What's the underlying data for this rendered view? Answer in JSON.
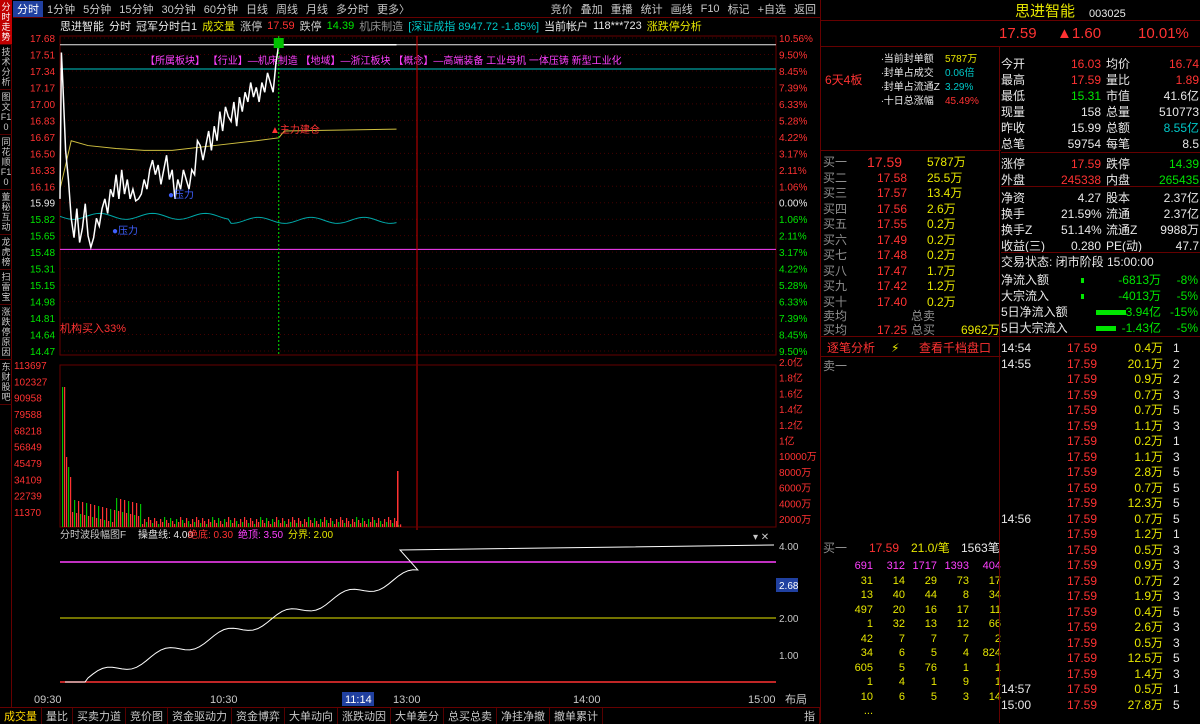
{
  "sidebar": [
    "分时走势",
    "技术分析",
    "图文F10",
    "同花顺F10",
    "董秘互动",
    "龙虎榜",
    "扫雷宝",
    "涨跌停原因",
    "东财股吧"
  ],
  "toolbar": {
    "tabs": [
      "分时",
      "1分钟",
      "5分钟",
      "15分钟",
      "30分钟",
      "60分钟",
      "日线",
      "周线",
      "月线",
      "多分时",
      "更多〉"
    ],
    "right": [
      "竞价",
      "叠加",
      "重播",
      "统计",
      "画线",
      "F10",
      "标记",
      "+自选",
      "返回"
    ]
  },
  "info": {
    "name": "思进智能",
    "label_fenshi": "分时",
    "indicator": "冠军分时白1",
    "vol_label": "成交量",
    "zt_label": "涨停",
    "zt": "17.59",
    "dt_label": "跌停",
    "dt": "14.39",
    "industry": "机床制造",
    "index": "[深证成指 8947.72 -1.85%]",
    "account": "当前帐户",
    "account_val": "118***723",
    "analysis": "涨跌停分析"
  },
  "chart": {
    "price_ticks": [
      "17.68",
      "17.51",
      "17.34",
      "17.17",
      "17.00",
      "16.83",
      "16.67",
      "16.50",
      "16.33",
      "16.16",
      "15.99",
      "15.82",
      "15.65",
      "15.48",
      "15.31",
      "15.15",
      "14.98",
      "14.81",
      "14.64",
      "14.47"
    ],
    "pct_ticks": [
      "10.56%",
      "9.50%",
      "8.45%",
      "7.39%",
      "6.33%",
      "5.28%",
      "4.22%",
      "3.17%",
      "2.11%",
      "1.06%",
      "0.00%",
      "1.06%",
      "2.11%",
      "3.17%",
      "4.22%",
      "5.28%",
      "6.33%",
      "7.39%",
      "8.45%",
      "9.50%"
    ],
    "vol_ticks": [
      "113697",
      "102327",
      "90958",
      "79588",
      "68218",
      "56849",
      "45479",
      "34109",
      "22739",
      "11370"
    ],
    "vol_right": [
      "2.0亿",
      "1.8亿",
      "1.6亿",
      "1.4亿",
      "1.2亿",
      "1亿",
      "10000万",
      "8000万",
      "6000万",
      "4000万",
      "2000万"
    ],
    "sectors": "【所属板块】 【行业】—机床制造 【地域】—浙江板块 【概念】—高端装备 工业母机 一体压铸 新型工业化",
    "inst": "机构买入33%",
    "mark_dt": "主力建仓",
    "mark_bl": "压力",
    "mark_bl2": "压力",
    "price_line": [
      [
        0,
        16.0
      ],
      [
        0.5,
        17.51
      ],
      [
        1,
        17.2
      ],
      [
        2,
        16.5
      ],
      [
        3,
        16.2
      ],
      [
        4,
        15.8
      ],
      [
        5,
        15.6
      ],
      [
        6,
        15.9
      ],
      [
        7,
        15.55
      ],
      [
        8,
        15.7
      ],
      [
        9,
        15.95
      ],
      [
        10,
        15.62
      ],
      [
        11,
        15.5
      ],
      [
        12,
        15.6
      ],
      [
        13,
        15.8
      ],
      [
        14,
        15.72
      ],
      [
        15,
        15.9
      ],
      [
        16,
        16.0
      ],
      [
        17,
        15.85
      ],
      [
        18,
        16.1
      ],
      [
        19,
        16.02
      ],
      [
        20,
        16.25
      ],
      [
        21,
        16.0
      ],
      [
        22,
        16.3
      ],
      [
        23,
        16.05
      ],
      [
        24,
        16.2
      ],
      [
        25,
        16.0
      ],
      [
        26,
        16.1
      ],
      [
        27,
        15.98
      ],
      [
        28,
        16.0
      ],
      [
        29,
        16.05
      ],
      [
        30,
        16.2
      ],
      [
        31,
        16.1
      ],
      [
        32,
        16.3
      ],
      [
        33,
        16.4
      ],
      [
        34,
        16.25
      ],
      [
        35,
        16.35
      ],
      [
        36,
        16.15
      ],
      [
        37,
        16.3
      ],
      [
        38,
        16.45
      ],
      [
        39,
        16.2
      ],
      [
        40,
        16.3
      ],
      [
        41,
        16.0
      ],
      [
        42,
        16.2
      ],
      [
        43,
        16.1
      ],
      [
        44,
        16.3
      ],
      [
        45,
        16.2
      ],
      [
        46,
        16.1
      ],
      [
        47,
        16.3
      ],
      [
        48,
        16.25
      ],
      [
        49,
        16.6
      ],
      [
        50,
        16.55
      ],
      [
        51,
        16.4
      ],
      [
        52,
        16.55
      ],
      [
        53,
        16.7
      ],
      [
        54,
        16.5
      ],
      [
        55,
        16.75
      ],
      [
        56,
        16.6
      ],
      [
        57,
        16.9
      ],
      [
        58,
        16.7
      ],
      [
        59,
        16.95
      ],
      [
        60,
        16.85
      ],
      [
        61,
        16.8
      ],
      [
        62,
        17.0
      ],
      [
        63,
        16.75
      ],
      [
        64,
        17.05
      ],
      [
        65,
        16.9
      ],
      [
        66,
        17.1
      ],
      [
        67,
        17.0
      ],
      [
        68,
        17.2
      ],
      [
        69,
        17.05
      ],
      [
        70,
        17.15
      ],
      [
        71,
        17.0
      ],
      [
        72,
        17.2
      ],
      [
        73,
        17.1
      ],
      [
        74,
        17.3
      ],
      [
        75,
        17.2
      ],
      [
        76,
        17.1
      ],
      [
        77,
        17.4
      ],
      [
        78,
        17.59
      ],
      [
        120,
        17.59
      ]
    ],
    "avg_line": [
      [
        0,
        16.1
      ],
      [
        4,
        16.6
      ],
      [
        10,
        16.55
      ],
      [
        20,
        16.52
      ],
      [
        30,
        16.5
      ],
      [
        40,
        16.5
      ],
      [
        55,
        16.55
      ],
      [
        70,
        16.6
      ],
      [
        78,
        16.63
      ],
      [
        80,
        16.7
      ],
      [
        120,
        16.72
      ]
    ],
    "mid_label": "分时波段幅图F",
    "mid_items": [
      "操盘线: 4.00",
      "绝底: 0.30",
      "绝顶: 3.50",
      "分界: 2.00"
    ],
    "mid_ticks": [
      "4.00",
      "2.68",
      "2.00",
      "1.00"
    ],
    "time_ticks": [
      "09:30",
      "10:30",
      "11:14",
      "13:00",
      "14:00",
      "15:00"
    ],
    "layout_btn": "布局"
  },
  "rp": {
    "name": "思进智能",
    "code": "003025",
    "price": "17.59",
    "chg": "▲1.60",
    "pct": "10.01%",
    "seal": [
      [
        "当前封单额",
        "5787万"
      ],
      [
        "封单占成交",
        "0.06倍"
      ],
      [
        "封单占流通Z",
        "3.29%"
      ],
      [
        "十日总涨幅",
        "45.49%"
      ]
    ],
    "board": "6天4板",
    "buy": [
      [
        "买一",
        "17.59",
        "5787万"
      ],
      [
        "买二",
        "17.58",
        "25.5万"
      ],
      [
        "买三",
        "17.57",
        "13.4万"
      ],
      [
        "买四",
        "17.56",
        "2.6万"
      ],
      [
        "买五",
        "17.55",
        "0.2万"
      ],
      [
        "买六",
        "17.49",
        "0.2万"
      ],
      [
        "买七",
        "17.48",
        "0.2万"
      ],
      [
        "买八",
        "17.47",
        "1.7万"
      ],
      [
        "买九",
        "17.42",
        "1.2万"
      ],
      [
        "买十",
        "17.40",
        "0.2万"
      ]
    ],
    "sell_avg": "卖均",
    "sell_total": "总卖",
    "buy_avg": "买均",
    "buy_avg_v": "17.25",
    "buy_total": "总买",
    "buy_total_v": "6962万",
    "stats": [
      [
        "今开",
        "16.03",
        "均价",
        "16.74"
      ],
      [
        "最高",
        "17.59",
        "量比",
        "1.89"
      ],
      [
        "最低",
        "15.31",
        "市值",
        "41.6亿"
      ],
      [
        "现量",
        "158",
        "总量",
        "510773"
      ],
      [
        "昨收",
        "15.99",
        "总额",
        "8.55亿"
      ],
      [
        "总笔",
        "59754",
        "每笔",
        "8.5"
      ]
    ],
    "stats2": [
      [
        "涨停",
        "17.59",
        "跌停",
        "14.39"
      ],
      [
        "外盘",
        "245338",
        "内盘",
        "265435"
      ]
    ],
    "stats3": [
      [
        "净资",
        "4.27",
        "股本",
        "2.37亿"
      ],
      [
        "换手",
        "21.59%",
        "流通",
        "2.37亿"
      ],
      [
        "换手Z",
        "51.14%",
        "流通Z",
        "9988万"
      ],
      [
        "收益(三)",
        "0.280",
        "PE(动)",
        "47.7"
      ]
    ],
    "trade_state": "交易状态: 闭市阶段 15:00:00",
    "flows": [
      [
        "净流入额",
        "-6813万",
        "-8%"
      ],
      [
        "大宗流入",
        "-4013万",
        "-5%"
      ],
      [
        "5日净流入额",
        "-3.94亿",
        "-15%"
      ],
      [
        "5日大宗流入",
        "-1.43亿",
        "-5%"
      ]
    ],
    "tab1": "逐笔分析",
    "tab2": "查看千档盘口",
    "sell1": "卖一",
    "queue_head": [
      "买一",
      "17.59",
      "21.0/笔",
      "1563笔"
    ],
    "queue": [
      [
        "691",
        "312",
        "1717",
        "1393",
        "404"
      ],
      [
        "31",
        "14",
        "29",
        "73",
        "17"
      ],
      [
        "13",
        "40",
        "44",
        "8",
        "34"
      ],
      [
        "497",
        "20",
        "16",
        "17",
        "11"
      ],
      [
        "1",
        "32",
        "13",
        "12",
        "66"
      ],
      [
        "42",
        "7",
        "7",
        "7",
        "2"
      ],
      [
        "34",
        "6",
        "5",
        "4",
        "824"
      ],
      [
        "605",
        "5",
        "76",
        "1",
        "1"
      ],
      [
        "1",
        "4",
        "1",
        "9",
        "1"
      ],
      [
        "10",
        "6",
        "5",
        "3",
        "14"
      ],
      [
        "...",
        "",
        "",
        "",
        ""
      ]
    ],
    "ticks": [
      [
        "14:54",
        "17.59",
        "0.4万",
        "1"
      ],
      [
        "14:55",
        "17.59",
        "20.1万",
        "2"
      ],
      [
        "",
        "17.59",
        "0.9万",
        "2"
      ],
      [
        "",
        "17.59",
        "0.7万",
        "3"
      ],
      [
        "",
        "17.59",
        "0.7万",
        "5"
      ],
      [
        "",
        "17.59",
        "1.1万",
        "3"
      ],
      [
        "",
        "17.59",
        "0.2万",
        "1"
      ],
      [
        "",
        "17.59",
        "1.1万",
        "3"
      ],
      [
        "",
        "17.59",
        "2.8万",
        "5"
      ],
      [
        "",
        "17.59",
        "0.7万",
        "5"
      ],
      [
        "",
        "17.59",
        "12.3万",
        "5"
      ],
      [
        "14:56",
        "17.59",
        "0.7万",
        "5"
      ],
      [
        "",
        "17.59",
        "1.2万",
        "1"
      ],
      [
        "",
        "17.59",
        "0.5万",
        "3"
      ],
      [
        "",
        "17.59",
        "0.9万",
        "3"
      ],
      [
        "",
        "17.59",
        "0.7万",
        "2"
      ],
      [
        "",
        "17.59",
        "1.9万",
        "3"
      ],
      [
        "",
        "17.59",
        "0.4万",
        "5"
      ],
      [
        "",
        "17.59",
        "2.6万",
        "3"
      ],
      [
        "",
        "17.59",
        "0.5万",
        "3"
      ],
      [
        "",
        "17.59",
        "12.5万",
        "5"
      ],
      [
        "",
        "17.59",
        "1.4万",
        "3"
      ],
      [
        "14:57",
        "17.59",
        "0.5万",
        "1"
      ],
      [
        "15:00",
        "17.59",
        "27.8万",
        "5"
      ]
    ]
  },
  "bottom": [
    "成交量",
    "量比",
    "买卖力道",
    "竞价图",
    "资金驱动力",
    "资金博弈",
    "大单动向",
    "涨跌动因",
    "大单差分",
    "总买总卖",
    "净挂净撤",
    "撤单累计"
  ],
  "bottom_right": "指"
}
